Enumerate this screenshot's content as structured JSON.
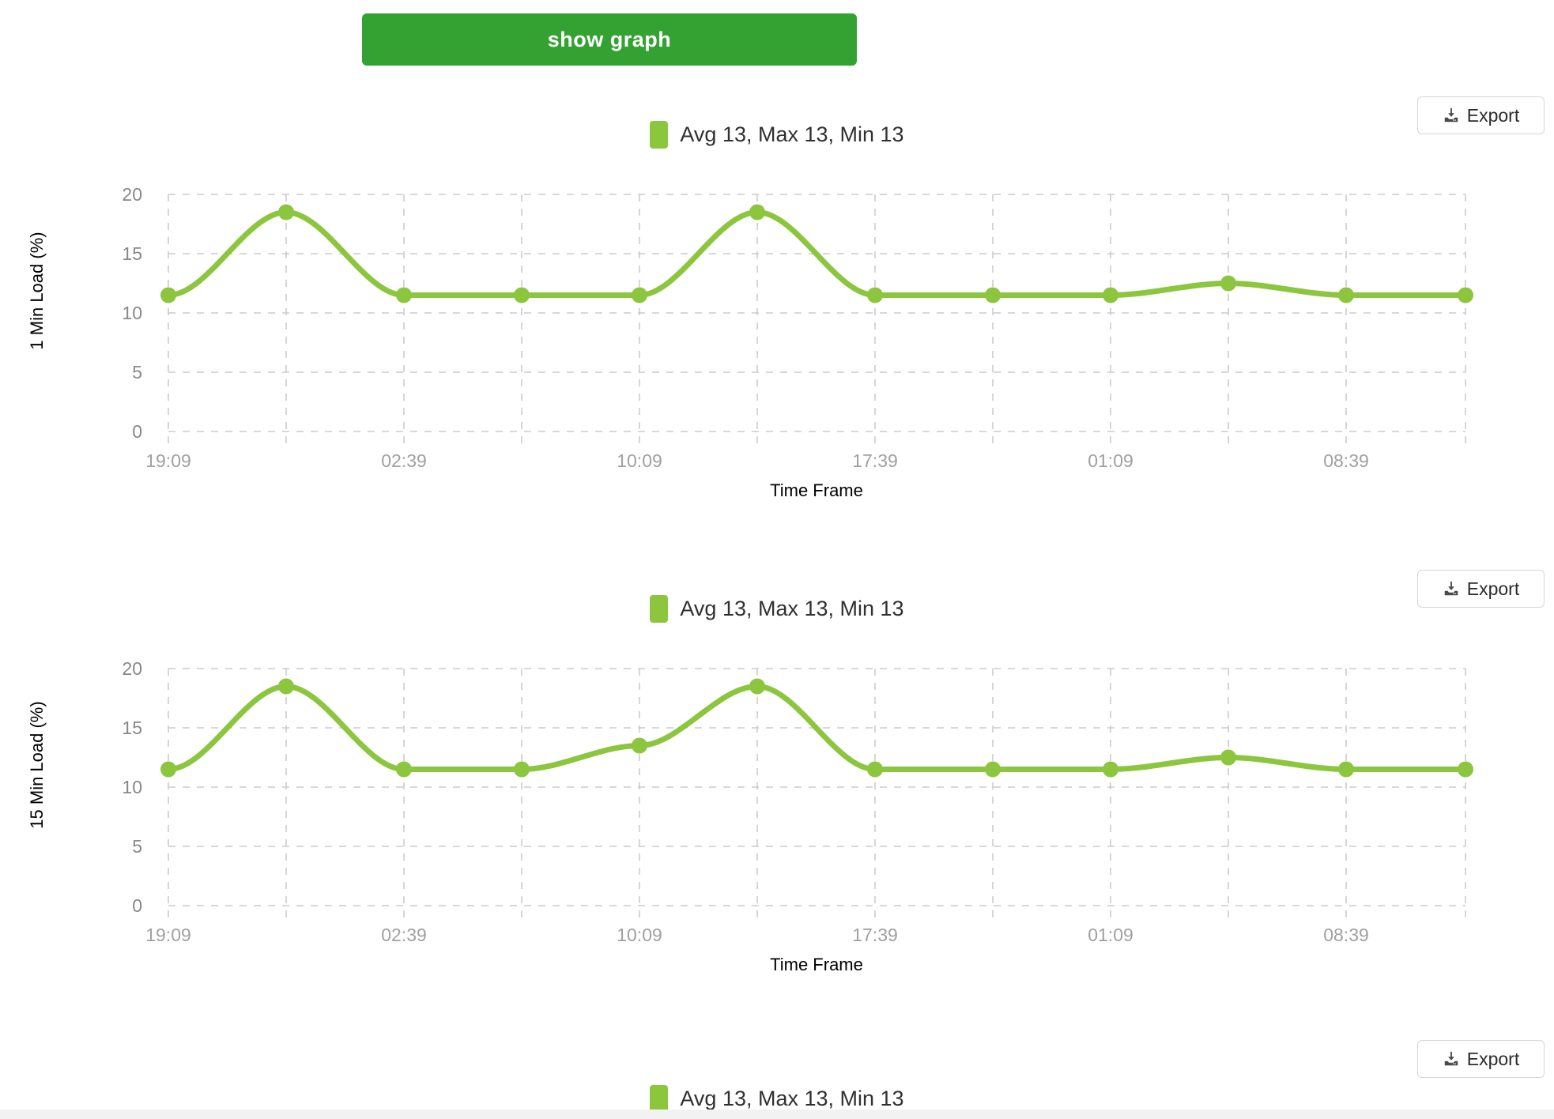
{
  "toolbar": {
    "show_graph_label": "show graph",
    "show_graph_color": "#34a233"
  },
  "export": {
    "label": "Export",
    "icon": "download-icon"
  },
  "theme": {
    "series_color": "#8cc63f",
    "grid_color": "#cccccc",
    "tick_color": "#a0a0a0",
    "page_background": "#ffffff"
  },
  "charts": [
    {
      "id": "chart-1-min-load",
      "legend": "Avg 13, Max 13, Min 13",
      "ylabel": "1 Min Load (%)",
      "xlabel": "Time Frame",
      "export_label": "Export"
    },
    {
      "id": "chart-15-min-load",
      "legend": "Avg 13, Max 13, Min 13",
      "ylabel": "15 Min Load (%)",
      "xlabel": "Time Frame",
      "export_label": "Export"
    },
    {
      "id": "chart-3-partial",
      "legend": "Avg 13, Max 13, Min 13",
      "ylabel": "",
      "xlabel": "",
      "export_label": "Export"
    }
  ],
  "chart_data": [
    {
      "type": "line",
      "title": "",
      "legend_entries": [
        "Avg 13, Max 13, Min 13"
      ],
      "legend_position": "top-center",
      "xlabel": "Time Frame",
      "ylabel": "1 Min Load (%)",
      "ylim": [
        0,
        20
      ],
      "yticks": [
        0,
        5,
        10,
        15,
        20
      ],
      "xticks": [
        "19:09",
        "02:39",
        "10:09",
        "17:39",
        "01:09",
        "08:39"
      ],
      "grid": true,
      "x": [
        "19:09",
        "22:54",
        "02:39",
        "06:24",
        "10:09",
        "13:54",
        "17:39",
        "21:24",
        "01:09",
        "04:54",
        "08:39",
        "12:24"
      ],
      "values": [
        11.5,
        18.5,
        11.5,
        11.5,
        11.5,
        18.5,
        11.5,
        11.5,
        11.5,
        12.5,
        11.5,
        11.5
      ],
      "series": [
        {
          "name": "Avg 13, Max 13, Min 13",
          "color": "#8cc63f",
          "values": [
            11.5,
            18.5,
            11.5,
            11.5,
            11.5,
            18.5,
            11.5,
            11.5,
            11.5,
            12.5,
            11.5,
            11.5
          ]
        }
      ]
    },
    {
      "type": "line",
      "title": "",
      "legend_entries": [
        "Avg 13, Max 13, Min 13"
      ],
      "legend_position": "top-center",
      "xlabel": "Time Frame",
      "ylabel": "15 Min Load (%)",
      "ylim": [
        0,
        20
      ],
      "yticks": [
        0,
        5,
        10,
        15,
        20
      ],
      "xticks": [
        "19:09",
        "02:39",
        "10:09",
        "17:39",
        "01:09",
        "08:39"
      ],
      "grid": true,
      "x": [
        "19:09",
        "22:54",
        "02:39",
        "06:24",
        "10:09",
        "13:54",
        "17:39",
        "21:24",
        "01:09",
        "04:54",
        "08:39",
        "12:24"
      ],
      "values": [
        11.5,
        18.5,
        11.5,
        11.5,
        13.5,
        18.5,
        11.5,
        11.5,
        11.5,
        12.5,
        11.5,
        11.5
      ],
      "series": [
        {
          "name": "Avg 13, Max 13, Min 13",
          "color": "#8cc63f",
          "values": [
            11.5,
            18.5,
            11.5,
            11.5,
            13.5,
            18.5,
            11.5,
            11.5,
            11.5,
            12.5,
            11.5,
            11.5
          ]
        }
      ]
    }
  ]
}
